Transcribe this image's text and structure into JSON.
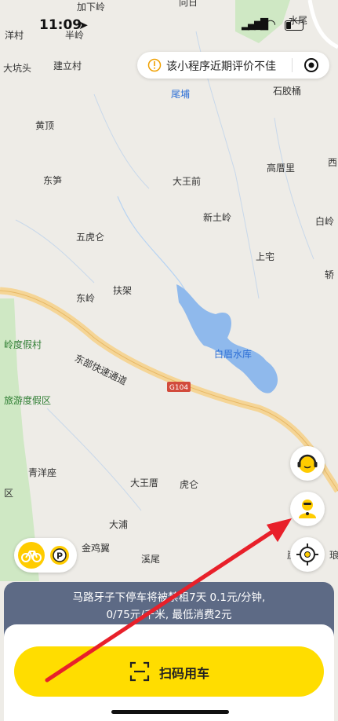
{
  "status_bar": {
    "time": "11:09"
  },
  "map_labels": [
    {
      "text": "加下岭",
      "color": "dark"
    },
    {
      "text": "向日",
      "color": "dark"
    },
    {
      "text": "洋村",
      "color": "dark"
    },
    {
      "text": "半岭",
      "color": "dark"
    },
    {
      "text": "水尾",
      "color": "dark"
    },
    {
      "text": "大坑头",
      "color": "dark"
    },
    {
      "text": "建立村",
      "color": "dark"
    },
    {
      "text": "尾埔",
      "color": "blue"
    },
    {
      "text": "石胶桶",
      "color": "dark"
    },
    {
      "text": "黄顶",
      "color": "dark"
    },
    {
      "text": "西",
      "color": "dark"
    },
    {
      "text": "高厝里",
      "color": "dark"
    },
    {
      "text": "东笋",
      "color": "dark"
    },
    {
      "text": "大王前",
      "color": "dark"
    },
    {
      "text": "新土岭",
      "color": "dark"
    },
    {
      "text": "白岭",
      "color": "dark"
    },
    {
      "text": "五虎仑",
      "color": "dark"
    },
    {
      "text": "上宅",
      "color": "dark"
    },
    {
      "text": "轿",
      "color": "dark"
    },
    {
      "text": "扶架",
      "color": "dark"
    },
    {
      "text": "东岭",
      "color": "dark"
    },
    {
      "text": "岭度假村",
      "color": "green"
    },
    {
      "text": "白眉水库",
      "color": "blue"
    },
    {
      "text": "东部快速通道",
      "color": "dark"
    },
    {
      "text": "旅游度假区",
      "color": "green"
    },
    {
      "text": "青洋座",
      "color": "dark"
    },
    {
      "text": "大王厝",
      "color": "dark"
    },
    {
      "text": "虎仑",
      "color": "dark"
    },
    {
      "text": "区",
      "color": "dark"
    },
    {
      "text": "大浦",
      "color": "dark"
    },
    {
      "text": "金鸡翼",
      "color": "dark"
    },
    {
      "text": "溪尾",
      "color": "dark"
    },
    {
      "text": "琅",
      "color": "dark"
    },
    {
      "text": "崖山",
      "color": "dark"
    }
  ],
  "road_badge": "G104",
  "rating_notice": {
    "text": "该小程序近期评价不佳"
  },
  "fee_notice": {
    "line1": "马路牙子下停车将被禁租7天 0.1元/分钟,",
    "line2": "0/75元/千米, 最低消费2元"
  },
  "scan_button": {
    "label": "扫码用车"
  },
  "colors": {
    "accent_yellow": "#ffdd00",
    "notice_bg": "#5d6a85",
    "annotation_red": "#e8202a",
    "water": "#8fb9ec",
    "road": "#f5d596"
  }
}
